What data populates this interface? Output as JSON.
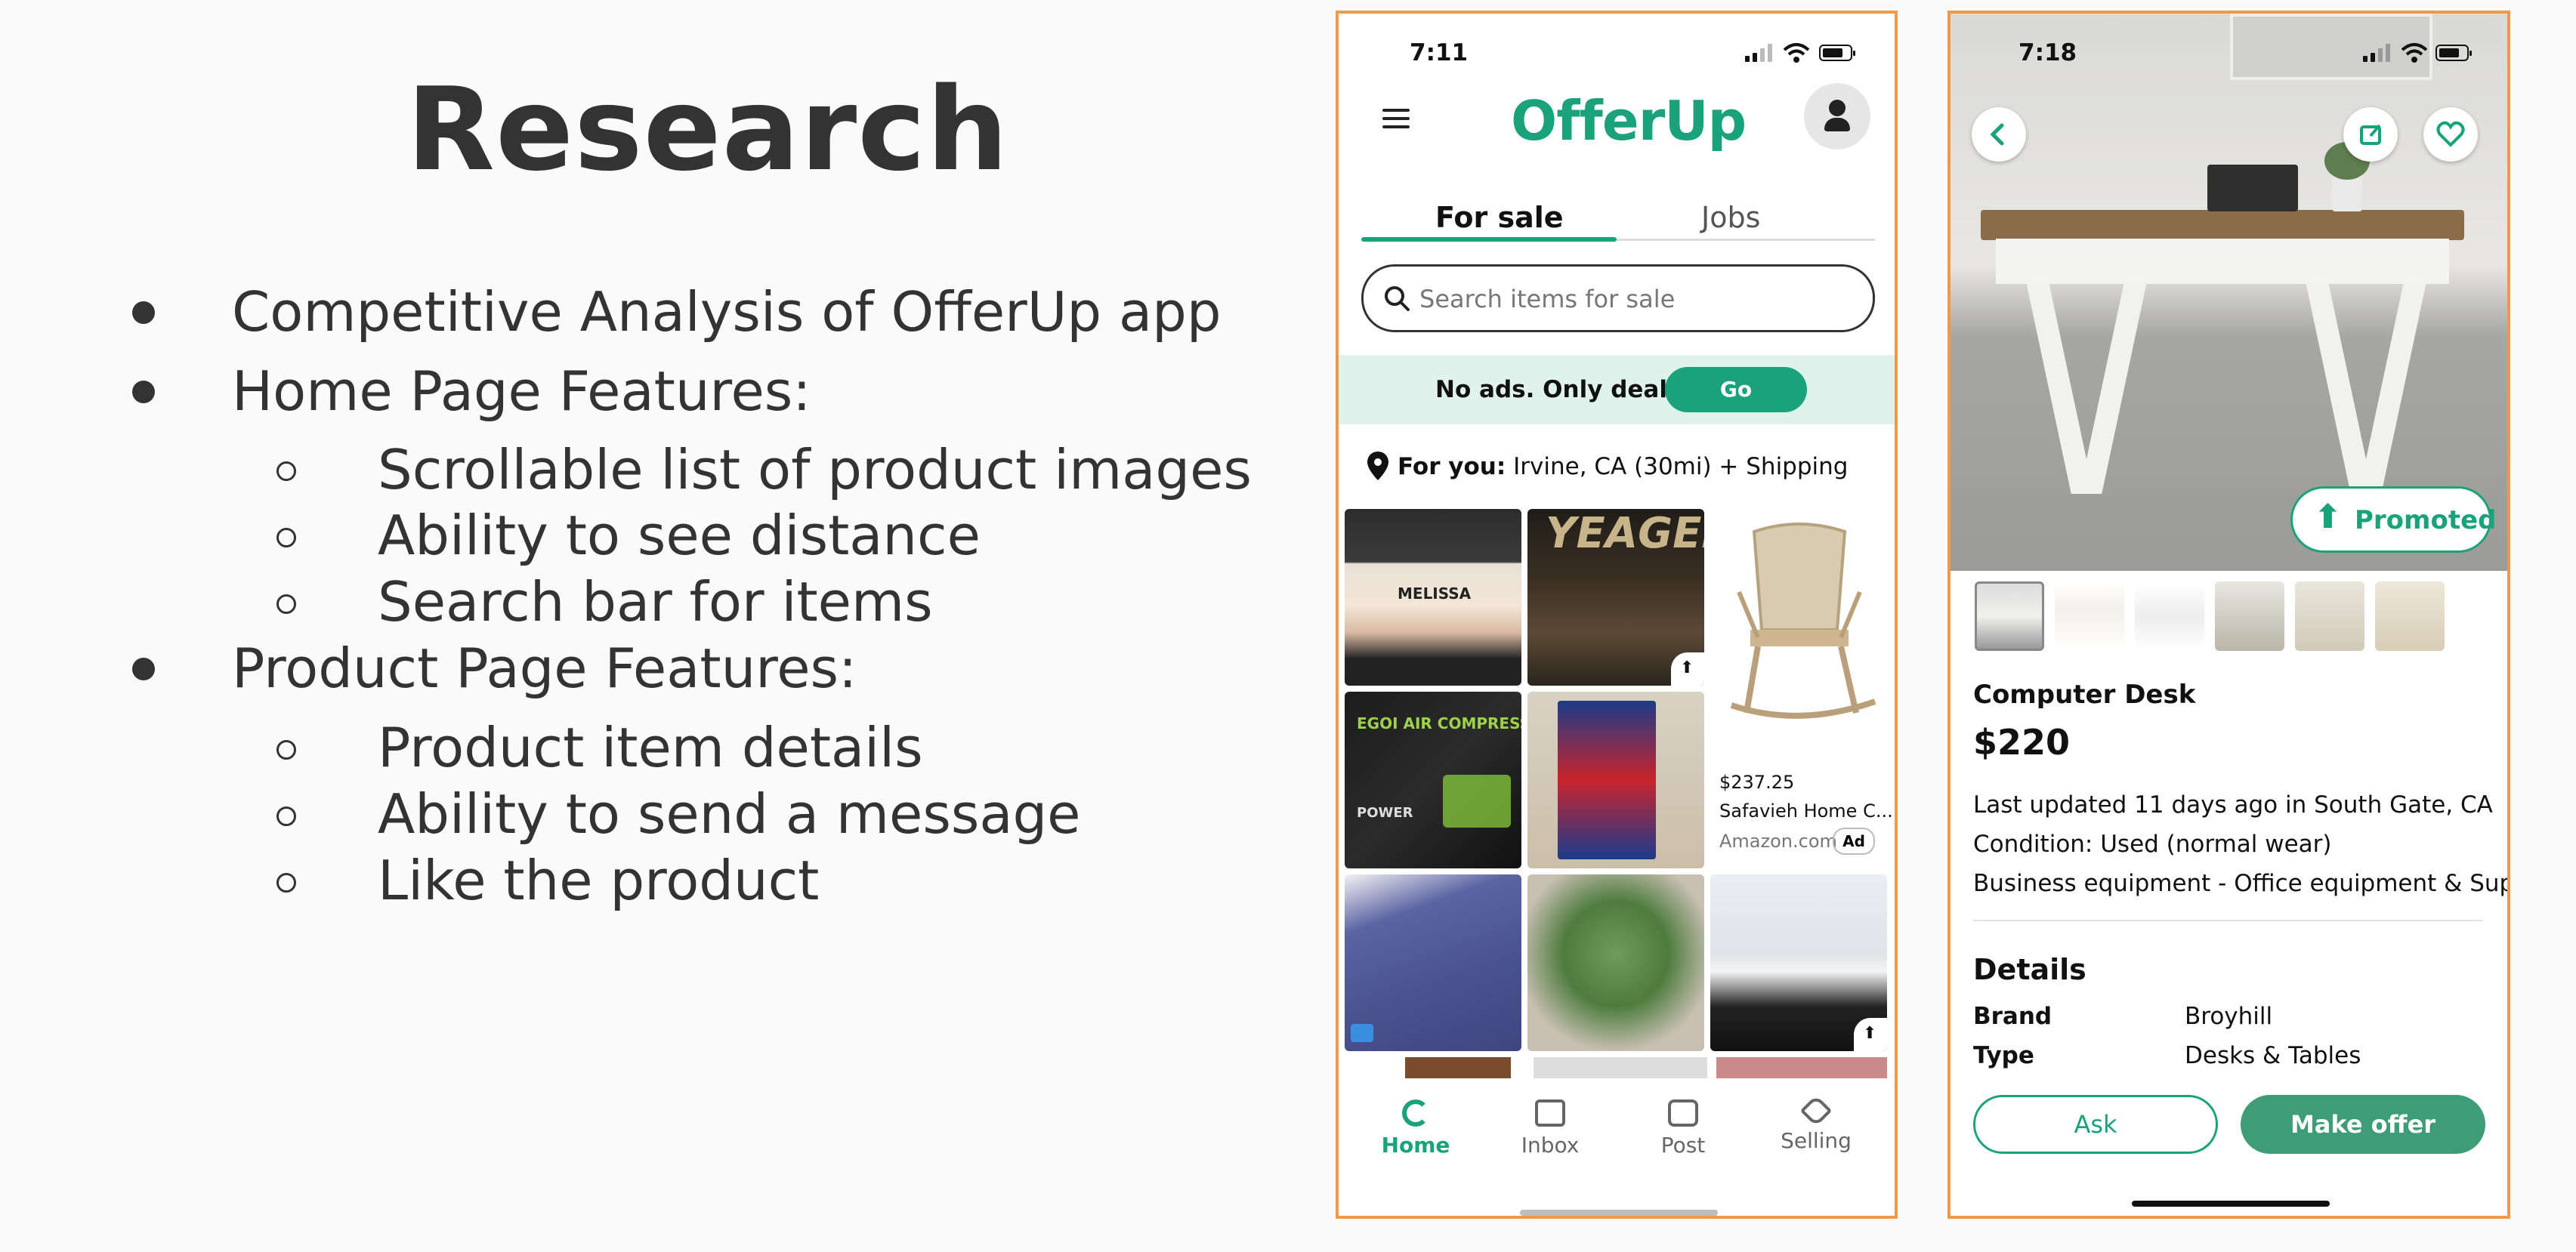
{
  "slide": {
    "title": "Research",
    "bullets": [
      {
        "text": "Competitive Analysis of OfferUp app"
      },
      {
        "text": "Home Page Features:"
      },
      {
        "text": "Scrollable list of product images"
      },
      {
        "text": "Ability to see distance"
      },
      {
        "text": "Search bar for items"
      },
      {
        "text": "Product Page Features:"
      },
      {
        "text": "Product item details"
      },
      {
        "text": "Ability to send a message"
      },
      {
        "text": "Like the product"
      }
    ]
  },
  "home_screen": {
    "status_time": "7:11",
    "logo": "OfferUp",
    "tabs": [
      "For sale",
      "Jobs"
    ],
    "search_placeholder": "Search items for sale",
    "promo_text": "No ads. Only deals.",
    "promo_button": "Go Premium",
    "location_prefix": "For you:",
    "location_text": "Irvine, CA (30mi) + Shipping",
    "ad": {
      "price": "$237.25",
      "title": "Safavieh Home C...",
      "source": "Amazon.com",
      "badge": "Ad"
    },
    "grid_labels": {
      "bed_text": "MELISSA",
      "poster_text": "YEAGER",
      "box_text": "EGOI AIR COMPRESS",
      "box_sub": "POWER"
    },
    "nav": [
      "Home",
      "Inbox",
      "Post",
      "Selling"
    ],
    "colors": {
      "brand": "#1aa37a",
      "promo_bg": "#dff3ec",
      "frame": "#ee9a4d"
    }
  },
  "product_screen": {
    "status_time": "7:18",
    "promoted_label": "Promoted",
    "title": "Computer Desk",
    "price": "$220",
    "last_updated": "Last updated 11 days ago in South Gate, CA",
    "condition": "Condition: Used (normal wear)",
    "category": "Business equipment - Office equipment & Supplies",
    "details_heading": "Details",
    "details": [
      {
        "label": "Brand",
        "value": "Broyhill"
      },
      {
        "label": "Type",
        "value": "Desks & Tables"
      }
    ],
    "ask_button": "Ask",
    "offer_button": "Make offer",
    "icons": [
      "back-arrow-icon",
      "share-icon",
      "heart-icon",
      "up-arrow-icon"
    ]
  }
}
